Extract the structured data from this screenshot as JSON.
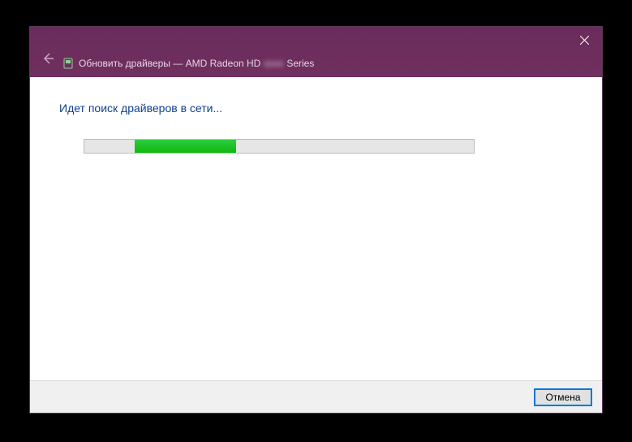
{
  "titlebar": {
    "title_prefix": "Обновить драйверы — AMD Radeon HD",
    "title_model": "xxxx",
    "title_suffix": "Series"
  },
  "content": {
    "status": "Идет поиск драйверов в сети...",
    "progress": {
      "left_pct": 13,
      "width_pct": 26
    }
  },
  "footer": {
    "cancel_label": "Отмена"
  }
}
